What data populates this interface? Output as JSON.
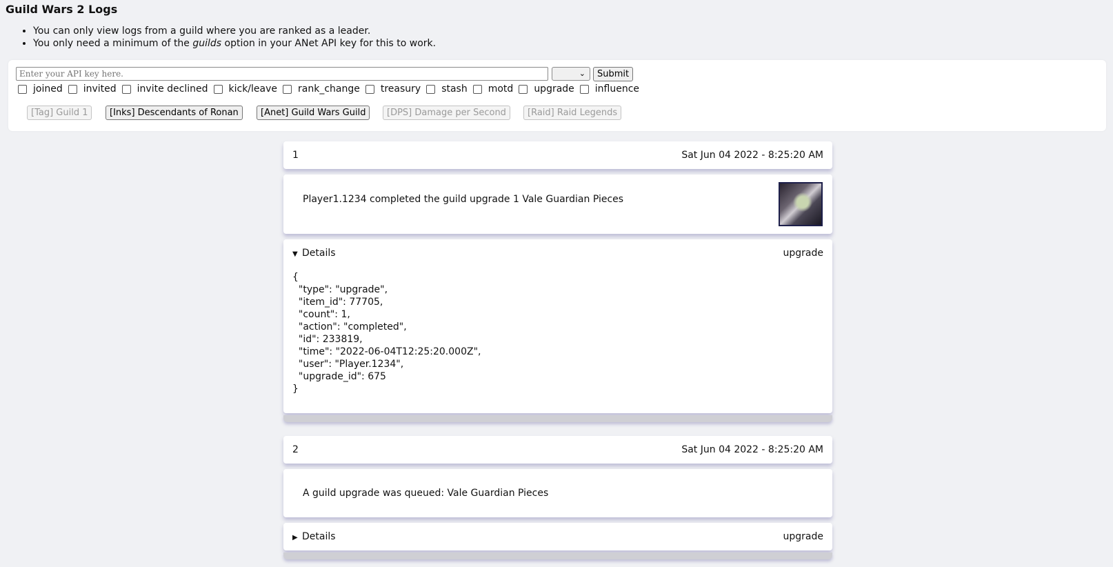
{
  "page": {
    "title": "Guild Wars 2 Logs",
    "notes": [
      {
        "before": "You can only view logs from a guild where you are ranked as a leader.",
        "em": "",
        "after": ""
      },
      {
        "before": "You only need a minimum of the ",
        "em": "guilds",
        "after": " option in your ANet API key for this to work."
      }
    ]
  },
  "controls": {
    "api_placeholder": "Enter your API key here.",
    "api_value": "",
    "select_value": "",
    "submit_label": "Submit",
    "filters": [
      "joined",
      "invited",
      "invite declined",
      "kick/leave",
      "rank_change",
      "treasury",
      "stash",
      "motd",
      "upgrade",
      "influence"
    ],
    "guilds": [
      {
        "label": "[Tag] Guild 1",
        "enabled": false
      },
      {
        "label": "[Inks] Descendants of Ronan",
        "enabled": true
      },
      {
        "label": "[Anet] Guild Wars Guild",
        "enabled": true
      },
      {
        "label": "[DPS] Damage per Second",
        "enabled": false
      },
      {
        "label": "[Raid] Raid Legends",
        "enabled": false
      }
    ]
  },
  "entries": [
    {
      "num": "1",
      "time": "Sat Jun 04 2022 - 8:25:20 AM",
      "message": "Player1.1234 completed the guild upgrade 1 Vale Guardian Pieces",
      "icon": "vale-guardian-pieces-icon",
      "details_label": "Details",
      "details_open": true,
      "type": "upgrade",
      "json": "{\n  \"type\": \"upgrade\",\n  \"item_id\": 77705,\n  \"count\": 1,\n  \"action\": \"completed\",\n  \"id\": 233819,\n  \"time\": \"2022-06-04T12:25:20.000Z\",\n  \"user\": \"Player.1234\",\n  \"upgrade_id\": 675\n}"
    },
    {
      "num": "2",
      "time": "Sat Jun 04 2022 - 8:25:20 AM",
      "message": "A guild upgrade was queued: Vale Guardian Pieces",
      "details_label": "Details",
      "details_open": false,
      "type": "upgrade"
    }
  ]
}
